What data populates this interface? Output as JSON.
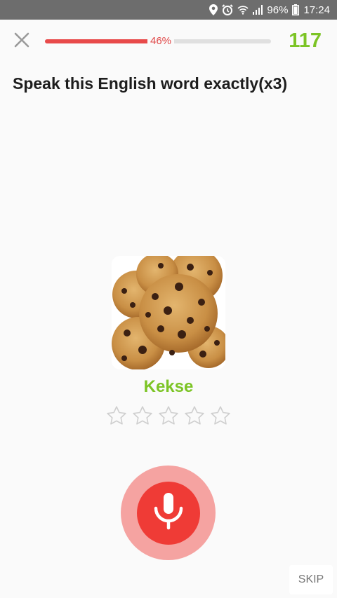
{
  "status_bar": {
    "battery": "96%",
    "time": "17:24",
    "icons": [
      "location-icon",
      "alarm-icon",
      "wifi-icon",
      "signal-icon",
      "battery-icon"
    ]
  },
  "header": {
    "close_icon": "close-icon",
    "progress_percent": 46,
    "progress_label": "46%",
    "score": "117"
  },
  "prompt": {
    "title": "Speak this English word exactly(x3)"
  },
  "card": {
    "image": "cookies-image",
    "word": "Kekse",
    "rating": {
      "filled": 0,
      "max": 5
    }
  },
  "actions": {
    "mic_icon": "microphone-icon",
    "skip_label": "SKIP"
  },
  "colors": {
    "accent_green": "#7cc425",
    "progress_red": "#e84a4a",
    "mic_red": "#ef3b36",
    "mic_halo": "#f5a3a1",
    "status_bar": "#6d6d6d"
  }
}
